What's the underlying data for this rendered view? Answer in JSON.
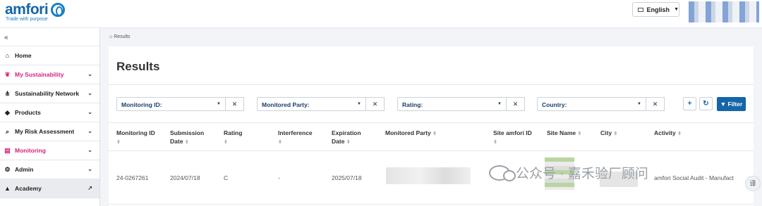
{
  "header": {
    "logo_text": "amfori",
    "logo_tagline": "Trade with purpose",
    "language": "English"
  },
  "sidebar": {
    "collapse_glyph": "«",
    "items": [
      {
        "label": "Home",
        "icon": "home-icon"
      },
      {
        "label": "My Sustainability",
        "icon": "leaf-icon",
        "active": true
      },
      {
        "label": "Sustainability Network",
        "icon": "network-icon"
      },
      {
        "label": "Products",
        "icon": "tag-icon"
      },
      {
        "label": "My Risk Assessment",
        "icon": "risk-search-icon"
      },
      {
        "label": "Monitoring",
        "icon": "clipboard-icon",
        "active": true
      },
      {
        "label": "Admin",
        "icon": "gear-icon"
      },
      {
        "label": "Academy",
        "icon": "graduation-cap-icon"
      }
    ]
  },
  "breadcrumb": "Results",
  "page_title": "Results",
  "filters": [
    {
      "label": "Monitoring ID:"
    },
    {
      "label": "Monitored Party:"
    },
    {
      "label": "Rating:"
    },
    {
      "label": "Country:"
    }
  ],
  "actions": {
    "add": "+",
    "refresh": "↻",
    "filter": "Filter"
  },
  "table": {
    "columns": [
      [
        "Monitoring ID"
      ],
      [
        "Submission",
        "Date"
      ],
      [
        "Rating"
      ],
      [
        "Interference"
      ],
      [
        "Expiration",
        "Date"
      ],
      [
        "Monitored Party"
      ],
      [
        "Site amfori ID"
      ],
      [
        "Site Name"
      ],
      [
        "City"
      ],
      [
        "Activity"
      ]
    ],
    "rows": [
      {
        "monitoring_id": "24-0267261",
        "submission_date": "2024/07/18",
        "rating": "C",
        "interference": "-",
        "expiration_date": "2025/07/18",
        "activity": "amfori Social Audit - Manufact"
      }
    ]
  },
  "watermark": "公众号 · 嘉禾验厂顾问",
  "translate_button": "译",
  "colors": {
    "brand_blue": "#1565a8",
    "accent_pink": "#d6247c"
  }
}
